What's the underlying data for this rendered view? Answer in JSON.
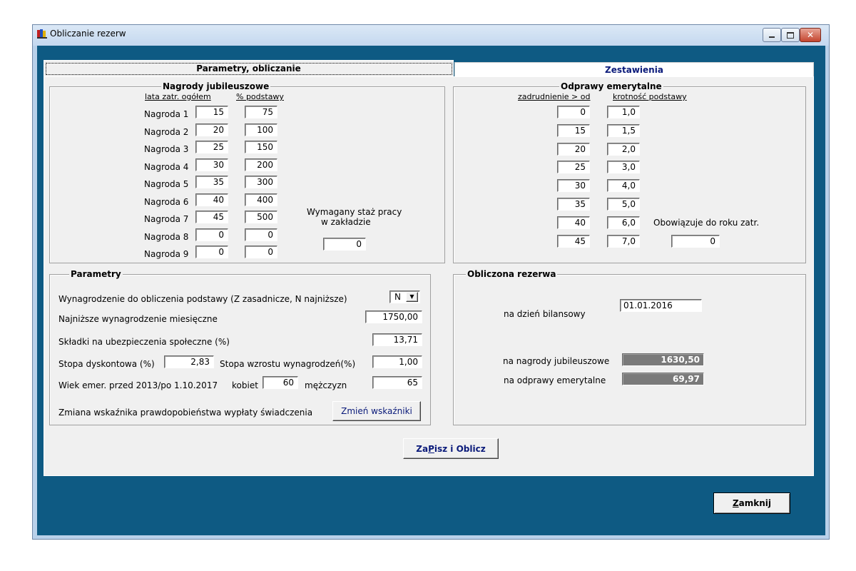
{
  "window": {
    "title": "Obliczanie rezerw"
  },
  "tabs": {
    "params": "Parametry, obliczanie",
    "summary": "Zestawienia"
  },
  "jubilee": {
    "title": "Nagrody jubileuszowe",
    "col_years": "lata zatr. ogółem",
    "col_percent": "% podstawy",
    "rows": [
      {
        "label": "Nagroda 1",
        "years": "15",
        "percent": "75"
      },
      {
        "label": "Nagroda 2",
        "years": "20",
        "percent": "100"
      },
      {
        "label": "Nagroda 3",
        "years": "25",
        "percent": "150"
      },
      {
        "label": "Nagroda 4",
        "years": "30",
        "percent": "200"
      },
      {
        "label": "Nagroda 5",
        "years": "35",
        "percent": "300"
      },
      {
        "label": "Nagroda 6",
        "years": "40",
        "percent": "400"
      },
      {
        "label": "Nagroda 7",
        "years": "45",
        "percent": "500"
      },
      {
        "label": "Nagroda 8",
        "years": "0",
        "percent": "0"
      },
      {
        "label": "Nagroda 9",
        "years": "0",
        "percent": "0"
      }
    ],
    "required_label_1": "Wymagany staż pracy",
    "required_label_2": "w zakładzie",
    "required_value": "0"
  },
  "severance": {
    "title": "Odprawy emerytalne",
    "col_employment": "zadrudnienie > od",
    "col_multiple": "krotność podstawy",
    "rows": [
      {
        "from": "0",
        "mult": "1,0"
      },
      {
        "from": "15",
        "mult": "1,5"
      },
      {
        "from": "20",
        "mult": "2,0"
      },
      {
        "from": "25",
        "mult": "3,0"
      },
      {
        "from": "30",
        "mult": "4,0"
      },
      {
        "from": "35",
        "mult": "5,0"
      },
      {
        "from": "40",
        "mult": "6,0"
      },
      {
        "from": "45",
        "mult": "7,0"
      }
    ],
    "valid_label": "Obowiązuje do roku zatr.",
    "valid_value": "0"
  },
  "params": {
    "title": "Parametry",
    "wage_basis_label": "Wynagrodzenie do obliczenia podstawy (Z zasadnicze, N najniższe)",
    "wage_basis_value": "N",
    "min_wage_label": "Najniższe wynagrodzenie miesięczne",
    "min_wage_value": "1750,00",
    "social_label": "Składki na ubezpieczenia społeczne (%)",
    "social_value": "13,71",
    "discount_label": "Stopa dyskontowa (%)",
    "discount_value": "2,83",
    "growth_label": "Stopa wzrostu wynagrodzeń(%)",
    "growth_value": "1,00",
    "retire_label": "Wiek emer. przed 2013/po 1.10.2017",
    "women_label": "kobiet",
    "women_value": "60",
    "men_label": "mężczyzn",
    "men_value": "65",
    "change_label": "Zmiana wskaźnika prawdopobieństwa wypłaty świadczenia",
    "change_button": "Zmień wskaźniki"
  },
  "reserve": {
    "title": "Obliczona rezerwa",
    "date_label": "na dzień bilansowy",
    "date_value": "01.01.2016",
    "jubilee_label": "na nagrody  jubileuszowe",
    "jubilee_value": "1630,50",
    "severance_label": "na odprawy emerytalne",
    "severance_value": "69,97"
  },
  "buttons": {
    "save_pre": "Za",
    "save_key": "P",
    "save_post": "isz i Oblicz",
    "close_key": "Z",
    "close_post": "amknij"
  },
  "colors": {
    "client_bg": "#0e5a83",
    "panel_bg": "#f0f0f0",
    "result_bg": "#7a7a7a",
    "tab_text": "#0a1a7a"
  }
}
